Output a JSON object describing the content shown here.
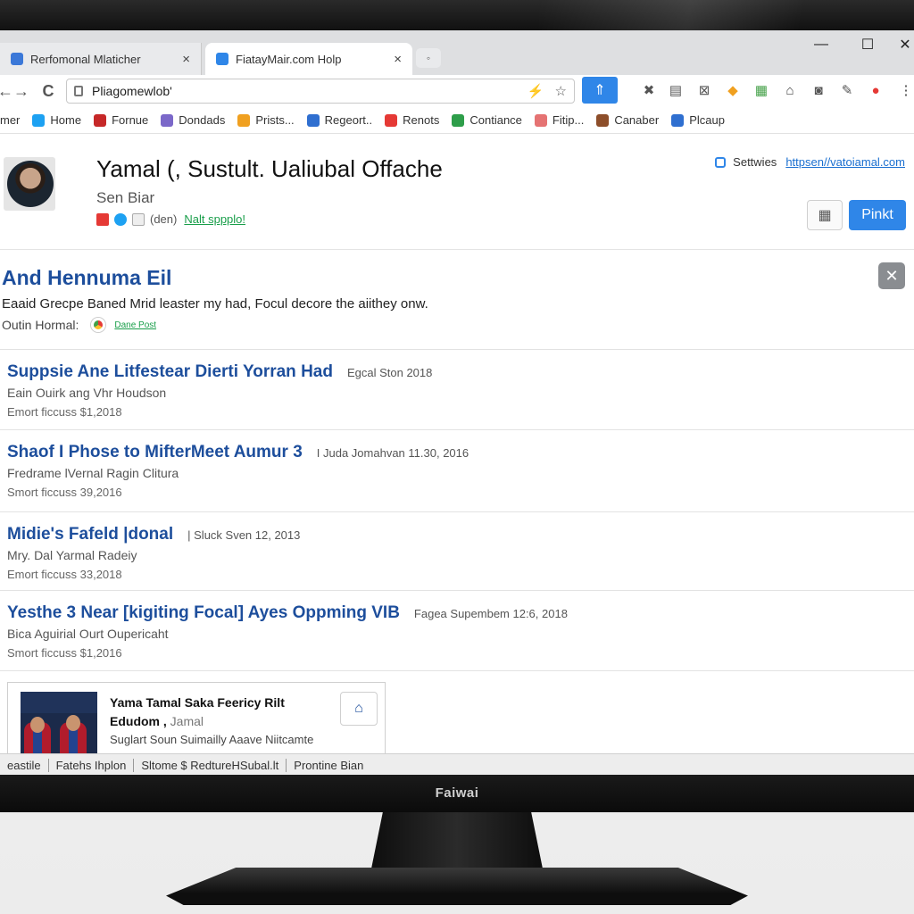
{
  "tabs": [
    {
      "label": "Rerfomonal Mlaticher",
      "close": "×",
      "icon_color": "#3b78d8"
    },
    {
      "label": "FiatayMair.com Holp",
      "close": "×",
      "icon_color": "#2f86e8"
    }
  ],
  "window_controls": {
    "minimize": "—",
    "maximize": "☐",
    "close": "✕"
  },
  "new_tab_icon": "◦",
  "nav": {
    "back": "←",
    "forward": "→",
    "reload": "C"
  },
  "address_bar": {
    "value": "Pliagomewlob'",
    "star": "☆",
    "bolt": "⚡"
  },
  "extensions": {
    "primary": "⇑",
    "items": [
      {
        "name": "x-icon",
        "glyph": "✖",
        "color": "#555"
      },
      {
        "name": "bookmark-icon",
        "glyph": "▤",
        "color": "#555"
      },
      {
        "name": "box-x-icon",
        "glyph": "⊠",
        "color": "#555"
      },
      {
        "name": "shapes-icon",
        "glyph": "◆",
        "color": "#f0a020"
      },
      {
        "name": "puzzle-icon",
        "glyph": "▦",
        "color": "#43a047"
      },
      {
        "name": "home-icon",
        "glyph": "⌂",
        "color": "#444"
      },
      {
        "name": "camera-icon",
        "glyph": "◙",
        "color": "#555"
      },
      {
        "name": "pen-icon",
        "glyph": "✎",
        "color": "#555"
      },
      {
        "name": "record-icon",
        "glyph": "●",
        "color": "#e53935"
      },
      {
        "name": "menu-icon",
        "glyph": "⋮",
        "color": "#333"
      }
    ]
  },
  "bookmarks": [
    {
      "label": "mer",
      "color": ""
    },
    {
      "label": "Home",
      "color": "#1da1f2"
    },
    {
      "label": "Fornue",
      "color": "#c62828"
    },
    {
      "label": "Dondads",
      "color": "#7b68c9"
    },
    {
      "label": "Prists...",
      "color": "#f0a020"
    },
    {
      "label": "Regeort..",
      "color": "#2f6fd0"
    },
    {
      "label": "Renots",
      "color": "#e53935"
    },
    {
      "label": "Contiance",
      "color": "#2e9e4a"
    },
    {
      "label": "Fitip...",
      "color": "#e57373"
    },
    {
      "label": "Canaber",
      "color": "#8d4e2a"
    },
    {
      "label": "Plcaup",
      "color": "#2f6fd0"
    }
  ],
  "profile": {
    "title": "Yamal (, Sustult. Ualiubal Offache",
    "subtitle": "Sen Biar",
    "meta_text": "(den)",
    "meta_link": "Nalt sppplo!",
    "settings_label": "Settwies",
    "settings_link": "httpsen//vatoiamal.com",
    "grid_icon": "▦",
    "primary_button": "Pinkt"
  },
  "highlight": {
    "title": "And Hennuma Eil",
    "text": "Eaaid Grecpe Baned Mrid leaster my had, Focul decore the aiithey onw.",
    "meta": "Outin Hormal:",
    "link": "Dane Post",
    "close": "✕"
  },
  "results": [
    {
      "title": "Suppsie Ane Litfestear Dierti Yorran Had",
      "date": "Egcal Ston 2018",
      "line1": "Eain Ouirk ang Vhr Houdson",
      "line2": "Emort ficcuss $1,2018"
    },
    {
      "title": "Shaof I Phose to MifterMeet Aumur 3",
      "date": "I Juda Jomahvan 11.30, 2016",
      "line1": "Fredrame lVernal Ragin Clitura",
      "line2": "Smort ficcuss 39,2016"
    },
    {
      "title": "Midie's Fafeld |donal",
      "date": "| Sluck Sven 12, 2013",
      "line1": "Mry. Dal Yarmal Radeiy",
      "line2": "Emort ficcuss 33,2018"
    },
    {
      "title": "Yesthe 3 Near [kigiting Focal] Ayes Oppming VIB",
      "date": "Fagea Supembem 12:6, 2018",
      "line1": "Bica Aguirial Ourt Oupericaht",
      "line2": "Smort ficcuss $1,2016"
    }
  ],
  "card": {
    "title": "Yama Tamal Saka Feericy Rilt Edudom ,",
    "author": "Jamal",
    "text": "Suglart Soun Suimailly Aaave Niitcamte",
    "button_icon": "⌂"
  },
  "statusbar": [
    "eastile",
    "Fatehs Ihplon",
    "Sltome $ RedtureHSubal.lt",
    "Prontine Bian"
  ],
  "monitor_brand": "Faiwai"
}
